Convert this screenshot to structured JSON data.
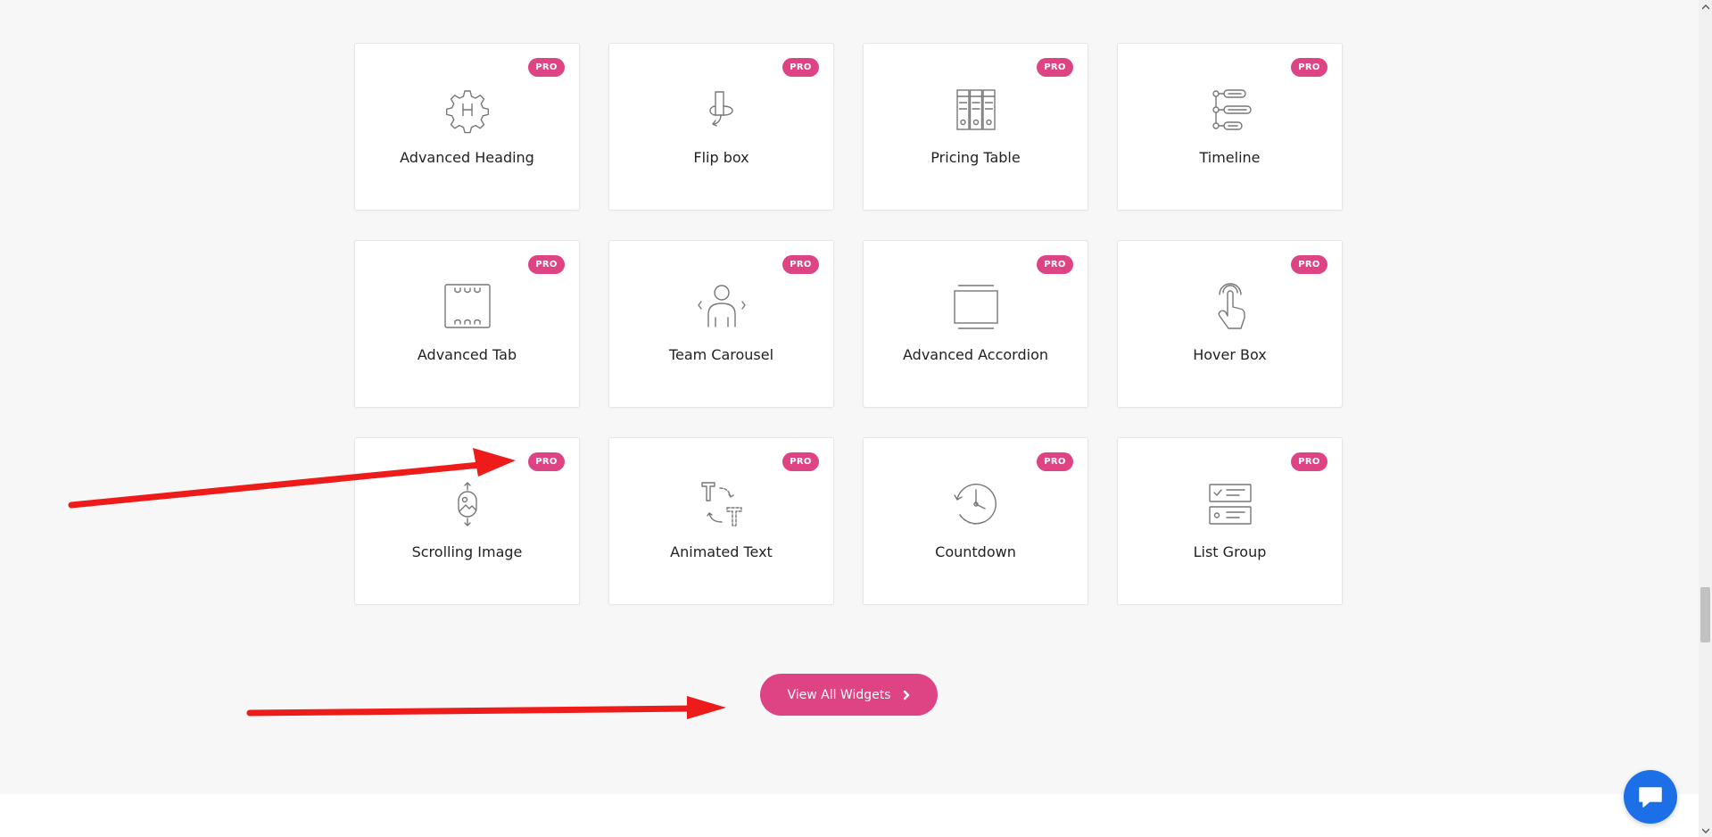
{
  "colors": {
    "accent": "#de4383",
    "icon_stroke": "#777777",
    "annotation": "#ee1b1b",
    "chat": "#1d6fe8"
  },
  "widgets": [
    {
      "title": "Advanced Heading",
      "badge": "PRO",
      "icon": "heading-gear-icon"
    },
    {
      "title": "Flip box",
      "badge": "PRO",
      "icon": "flip-box-icon"
    },
    {
      "title": "Pricing Table",
      "badge": "PRO",
      "icon": "pricing-table-icon"
    },
    {
      "title": "Timeline",
      "badge": "PRO",
      "icon": "timeline-icon"
    },
    {
      "title": "Advanced Tab",
      "badge": "PRO",
      "icon": "tabs-icon"
    },
    {
      "title": "Team Carousel",
      "badge": "PRO",
      "icon": "team-carousel-icon"
    },
    {
      "title": "Advanced Accordion",
      "badge": "PRO",
      "icon": "accordion-icon"
    },
    {
      "title": "Hover Box",
      "badge": "PRO",
      "icon": "hand-pointer-icon"
    },
    {
      "title": "Scrolling Image",
      "badge": "PRO",
      "icon": "scrolling-image-icon"
    },
    {
      "title": "Animated Text",
      "badge": "PRO",
      "icon": "animated-text-icon"
    },
    {
      "title": "Countdown",
      "badge": "PRO",
      "icon": "countdown-clock-icon"
    },
    {
      "title": "List Group",
      "badge": "PRO",
      "icon": "list-group-icon"
    }
  ],
  "cta": {
    "label": "View All Widgets",
    "icon": "chevron-right-icon"
  },
  "chat": {
    "icon": "chat-bubble-icon"
  }
}
